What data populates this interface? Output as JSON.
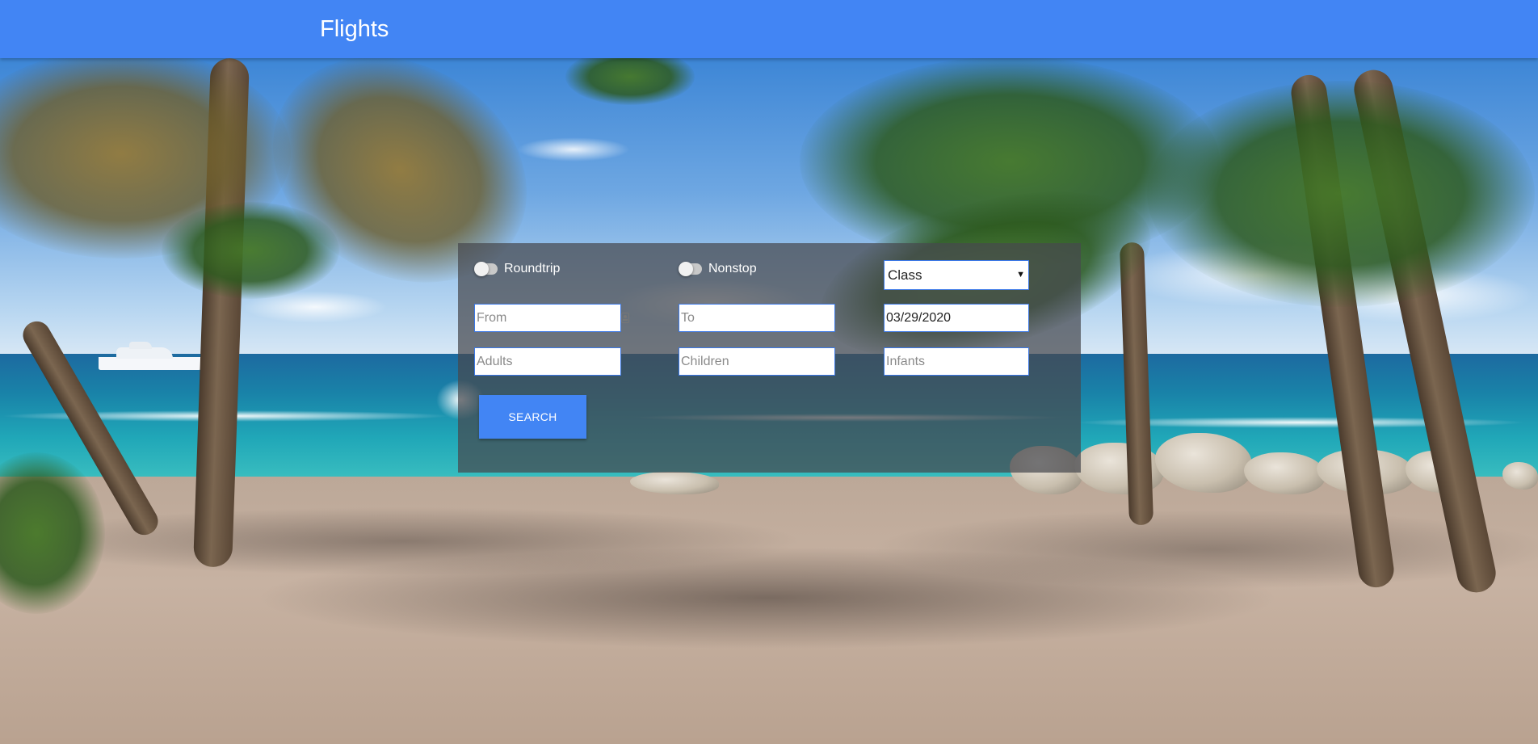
{
  "header": {
    "title": "Flights",
    "color": "#4285f4"
  },
  "search_form": {
    "roundtrip_label": "Roundtrip",
    "roundtrip_on": false,
    "nonstop_label": "Nonstop",
    "nonstop_on": false,
    "class_select": {
      "selected": "Class"
    },
    "from": {
      "placeholder": "From",
      "value": ""
    },
    "to": {
      "placeholder": "To",
      "value": ""
    },
    "date": {
      "value": "03/29/2020"
    },
    "adults": {
      "placeholder": "Adults",
      "value": ""
    },
    "children": {
      "placeholder": "Children",
      "value": ""
    },
    "infants": {
      "placeholder": "Infants",
      "value": ""
    },
    "search_label": "SEARCH",
    "from_icon": "contact-card-icon"
  },
  "background": {
    "scene": "tropical-beach-image"
  }
}
